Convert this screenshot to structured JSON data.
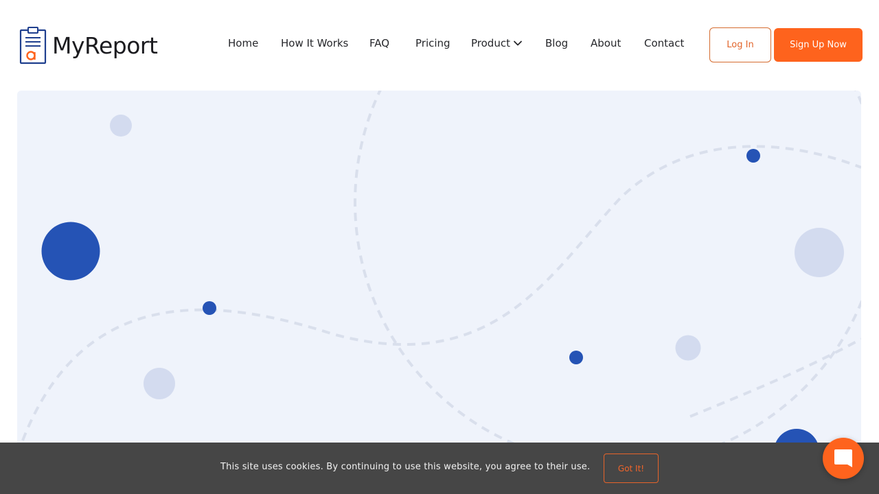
{
  "brand": {
    "name": "MyReport",
    "logo_icon": "clipboard-report-icon"
  },
  "nav": {
    "items": [
      {
        "label": "Home"
      },
      {
        "label": "How It Works"
      },
      {
        "label": "FAQ"
      },
      {
        "label": "Pricing"
      },
      {
        "label": "Product",
        "icon": "chevron-down-icon"
      },
      {
        "label": "Blog"
      },
      {
        "label": "About"
      },
      {
        "label": "Contact"
      }
    ]
  },
  "auth": {
    "login_label": "Log In",
    "signup_label": "Sign Up Now"
  },
  "cookie_banner": {
    "text": "This site uses cookies. By continuing to use this website, you agree to their use.",
    "button_label": "Got It!"
  },
  "chat_widget": {
    "icon": "chat-bubble-icon"
  },
  "colors": {
    "accent_orange": "#fe631d",
    "brand_blue": "#2553b5",
    "hero_background": "#eff3fb",
    "light_circle": "#d3dbef",
    "cookie_bar": "#464646"
  }
}
